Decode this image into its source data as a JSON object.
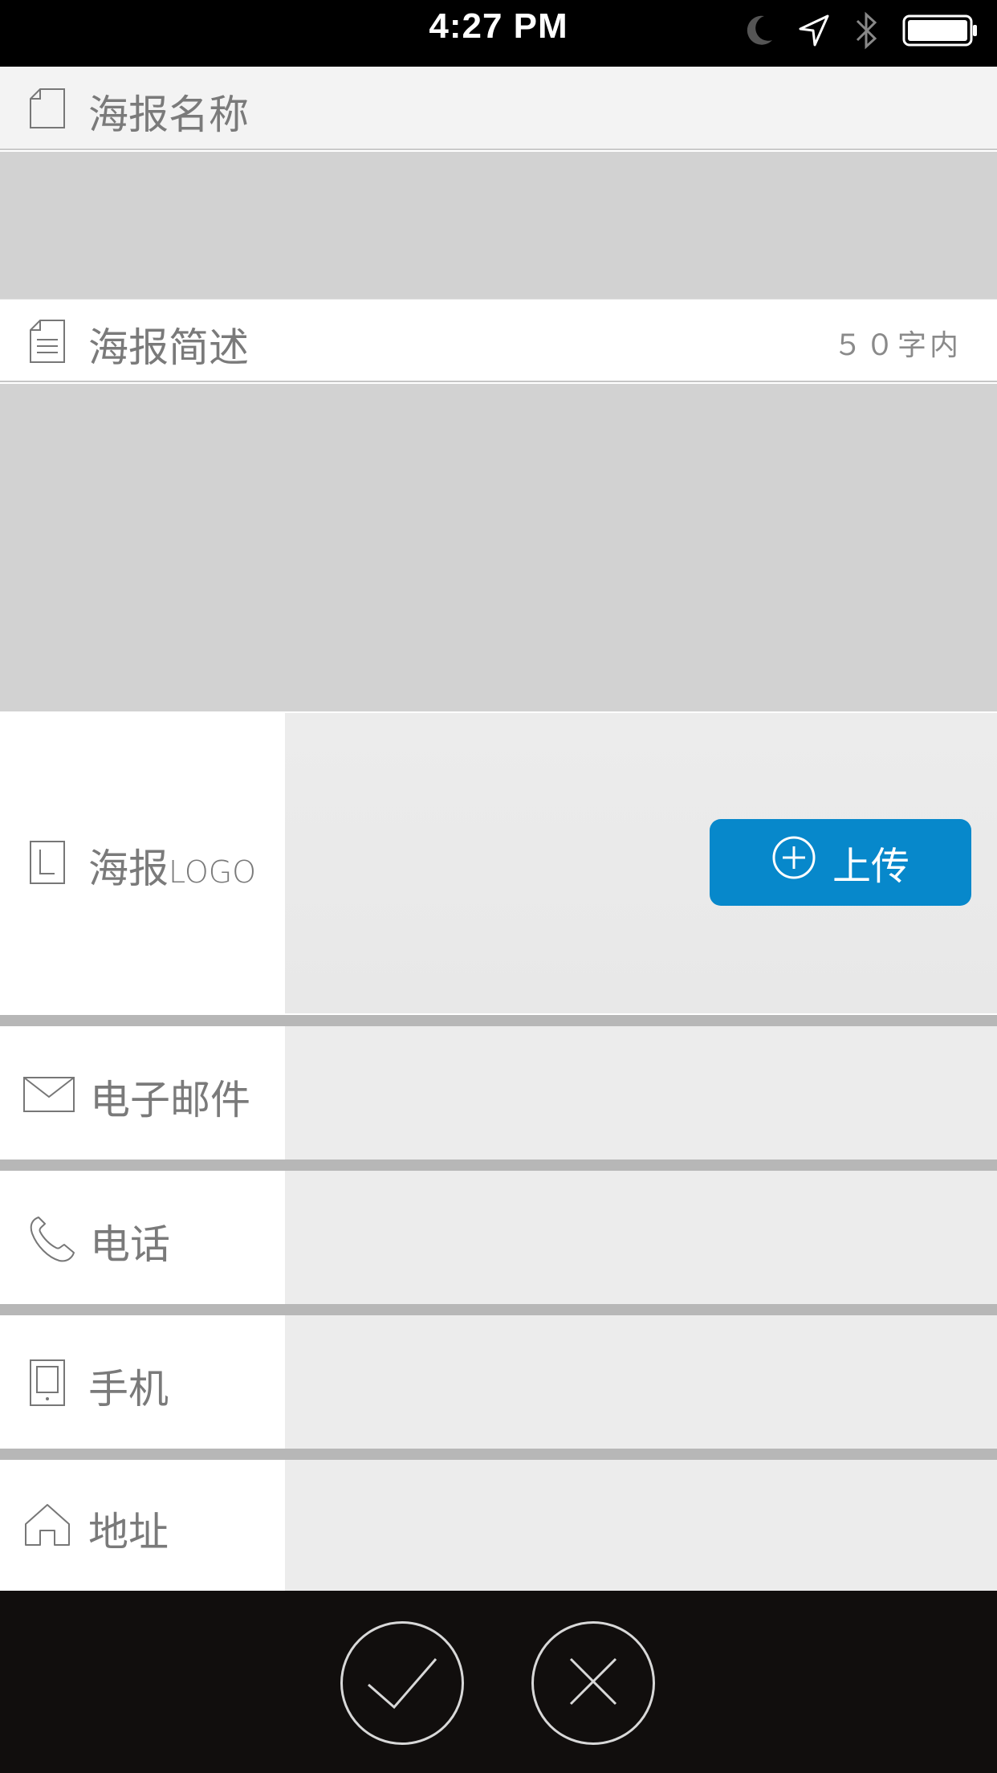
{
  "status_bar": {
    "time": "4:27 PM"
  },
  "poster_name": {
    "label": "海报名称"
  },
  "poster_desc": {
    "label": "海报简述",
    "limit": "５０字内"
  },
  "poster_logo": {
    "label_cn": "海报",
    "label_en": "LOGO",
    "upload_label": "上传"
  },
  "fields": {
    "email": "电子邮件",
    "phone": "电话",
    "mobile": "手机",
    "address": "地址"
  },
  "colors": {
    "accent": "#0788cb",
    "bottom_bar": "#110e0d"
  },
  "icons": [
    "moon-icon",
    "location-arrow-icon",
    "bluetooth-icon",
    "battery-icon",
    "document-icon",
    "document-lines-icon",
    "logo-l-icon",
    "mail-icon",
    "phone-icon",
    "mobile-icon",
    "home-icon",
    "plus-circle-icon",
    "check-icon",
    "close-icon"
  ]
}
